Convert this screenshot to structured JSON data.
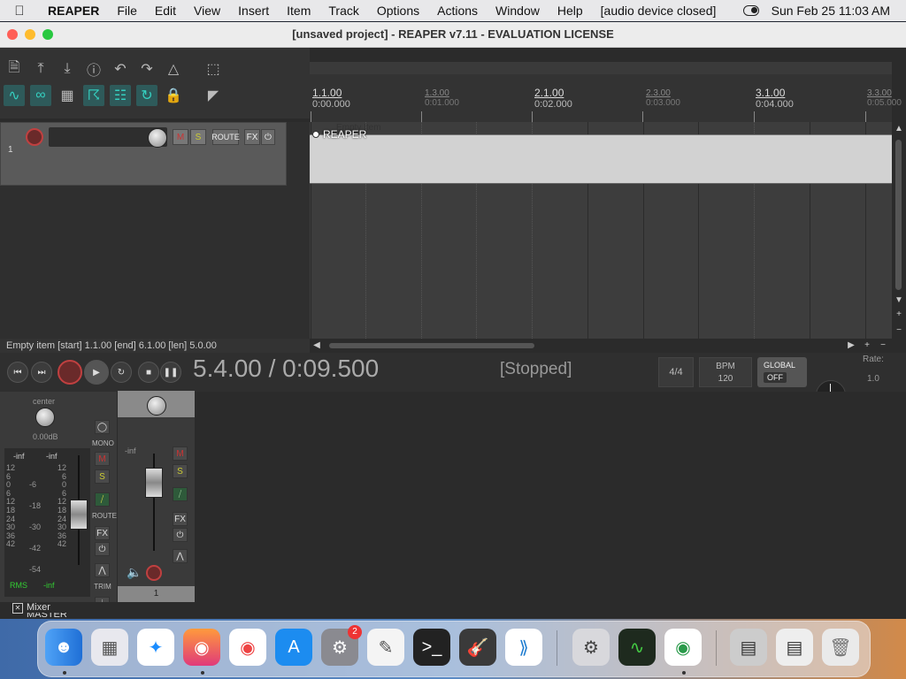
{
  "menubar": {
    "apple": "",
    "items": [
      "REAPER",
      "File",
      "Edit",
      "View",
      "Insert",
      "Item",
      "Track",
      "Options",
      "Actions",
      "Window",
      "Help",
      "[audio device closed]"
    ],
    "clock": "Sun Feb 25  11:03 AM"
  },
  "window": {
    "title": "[unsaved project] - REAPER v7.11 - EVALUATION LICENSE"
  },
  "ruler": {
    "marks": [
      {
        "bar": "1.1.00",
        "time": "0:00.000",
        "major": true
      },
      {
        "bar": "1.3.00",
        "time": "0:01.000",
        "major": false
      },
      {
        "bar": "2.1.00",
        "time": "0:02.000",
        "major": true
      },
      {
        "bar": "2.3.00",
        "time": "0:03.000",
        "major": false
      },
      {
        "bar": "3.1.00",
        "time": "0:04.000",
        "major": true
      },
      {
        "bar": "3.3.00",
        "time": "0:05.000",
        "major": false
      }
    ]
  },
  "track": {
    "number": "1",
    "mute": "M",
    "solo": "S",
    "route": "ROUTE",
    "fx": "FX"
  },
  "item": {
    "label": "Empty Item",
    "name": "REAPER"
  },
  "status": {
    "text": "Empty item [start] 1.1.00 [end] 6.1.00 [len] 5.0.00"
  },
  "transport": {
    "time": "5.4.00 / 0:09.500",
    "state": "[Stopped]",
    "time_sig": "4/4",
    "bpm_label": "BPM",
    "bpm": "120",
    "global_label": "GLOBAL",
    "global_state": "OFF",
    "rate_label": "Rate:",
    "rate": "1.0"
  },
  "master": {
    "pan": "center",
    "volume": "0.00dB",
    "peak_l": "-inf",
    "peak_r": "-inf",
    "scale_left": [
      "12",
      "6",
      "0",
      "6",
      "12",
      "18",
      "24",
      "30",
      "36",
      "42"
    ],
    "scale_mid": [
      "-6",
      "-18",
      "-30",
      "-42",
      "-54"
    ],
    "scale_right": [
      "12",
      "6",
      "0",
      "6",
      "12",
      "18",
      "24",
      "30",
      "36",
      "42"
    ],
    "rms_label": "RMS",
    "rms_value": "-inf",
    "name": "MASTER",
    "mono": "MONO",
    "mute": "M",
    "solo": "S",
    "route": "ROUTE",
    "fx": "FX",
    "trim": "TRIM",
    "info": "i"
  },
  "channel1": {
    "peak": "-inf",
    "mute": "M",
    "solo": "S",
    "fx": "FX",
    "number": "1"
  },
  "mixer_tab": {
    "label": "Mixer"
  },
  "dock": {
    "settings_badge": "2"
  },
  "colors": {
    "accent_teal": "#35d0c0",
    "record_red": "#c04040",
    "mute_red": "#cc3333",
    "solo_yellow": "#cccc33"
  }
}
